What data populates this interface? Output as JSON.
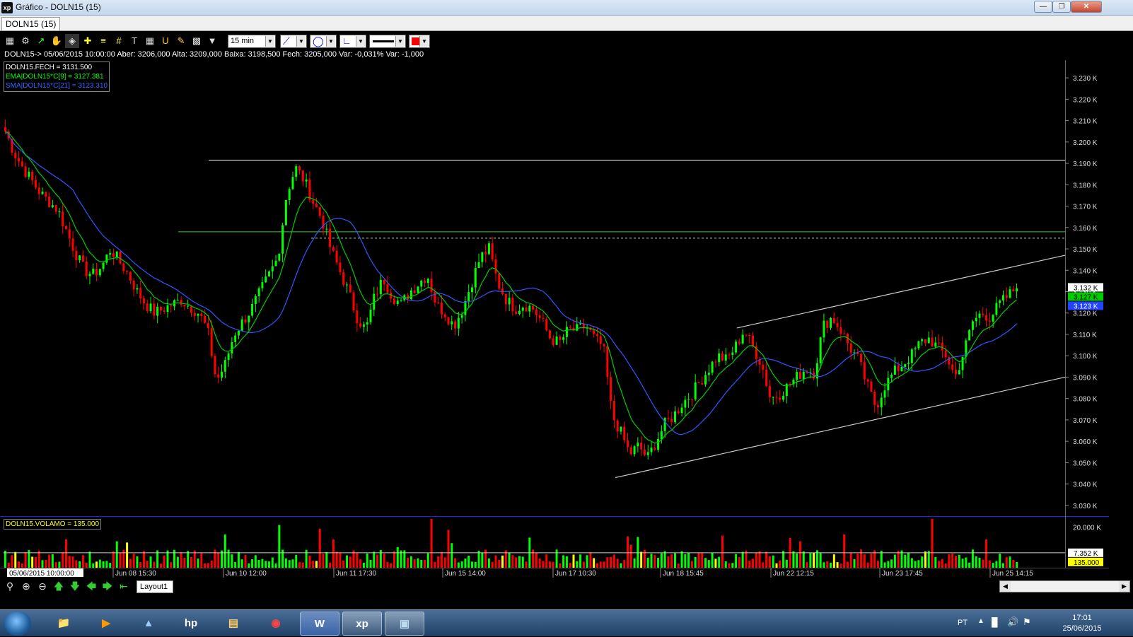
{
  "window": {
    "title": "Gráfico - DOLN15 (15)",
    "app_icon": "xp",
    "minimize_icon": "minimize-icon",
    "maximize_icon": "restore-icon",
    "close_icon": "close-icon"
  },
  "tab": {
    "label": "DOLN15 (15)"
  },
  "toolbar": {
    "interval": "15 min",
    "tools": [
      "chart-settings-icon",
      "gear-icon",
      "line-study-icon",
      "hand-icon",
      "indicator-icon",
      "crosshair-icon",
      "fibonacci-icon",
      "grid-icon",
      "text-icon",
      "calculator-icon",
      "magnet-icon",
      "paint-icon",
      "clipboard-icon",
      "filter-icon"
    ],
    "draw_color": "#ff0000"
  },
  "info_line": "DOLN15-> 05/06/2015 10:00:00 Aber: 3206,000 Alta: 3209,000 Baixa: 3198,500 Fech: 3205,000 Var: -0,031% Var: -1,000",
  "legend": [
    {
      "text": "DOLN15.FECH = 3131.500",
      "color": "#ffffff"
    },
    {
      "text": "EMA|DOLN15*C[9] = 3127.381",
      "color": "#00ff00"
    },
    {
      "text": "SMA|DOLN15*C[21] = 3123.310",
      "color": "#3366ff"
    }
  ],
  "volume_label": "DOLN15.VOLAMO = 135.000",
  "price_axis": {
    "ticks": [
      "3.230 K",
      "3.220 K",
      "3.210 K",
      "3.200 K",
      "3.190 K",
      "3.180 K",
      "3.170 K",
      "3.160 K",
      "3.150 K",
      "3.140 K",
      "3.130 K",
      "3.120 K",
      "3.110 K",
      "3.100 K",
      "3.090 K",
      "3.080 K",
      "3.070 K",
      "3.060 K",
      "3.050 K",
      "3.040 K",
      "3.030 K"
    ],
    "last_price": "3.132 K",
    "ema_value": "3.127 K",
    "sma_value": "3.123 K"
  },
  "volume_axis": {
    "tick": "20.000 K",
    "avg_value": "7.352 K",
    "last_value": "135.000"
  },
  "time_axis": [
    "05/06/2015 10:00:00",
    "Jun 08 15:30",
    "Jun 10 12:00",
    "Jun 11 17:30",
    "Jun 15 14:00",
    "Jun 17 10:30",
    "Jun 18 15:45",
    "Jun 22 12:15",
    "Jun 23 17:45",
    "Jun 25 14:15"
  ],
  "bottom_bar": {
    "layout_tab": "Layout1",
    "nav_icons": [
      "zoom-icon",
      "zoom-in-icon",
      "zoom-out-icon",
      "arrow-up-icon",
      "arrow-down-icon",
      "arrow-left-icon",
      "arrow-right-icon",
      "arrow-first-icon"
    ]
  },
  "taskbar": {
    "apps": [
      "folder-icon",
      "media-player-icon",
      "network-icon",
      "hp-icon",
      "scanner-icon",
      "chrome-icon",
      "word-icon",
      "xp-icon",
      "photo-viewer-icon"
    ],
    "language": "PT",
    "time": "17:01",
    "date": "25/06/2015"
  },
  "colors": {
    "up_candle": "#00ff00",
    "down_candle": "#ff0000",
    "ema": "#00cc00",
    "sma": "#3355ff",
    "resistance_line": "#ffffff",
    "green_hline": "#33cc33",
    "channel_lines": "#cccccc"
  },
  "chart_data": {
    "type": "candlestick",
    "symbol": "DOLN15",
    "interval": "15 min",
    "ylim": [
      3025,
      3235
    ],
    "closes_path": [
      3205,
      3195,
      3188,
      3182,
      3176,
      3172,
      3168,
      3158,
      3148,
      3140,
      3138,
      3142,
      3150,
      3144,
      3138,
      3130,
      3124,
      3120,
      3122,
      3124,
      3126,
      3123,
      3120,
      3112,
      3088,
      3096,
      3110,
      3116,
      3122,
      3130,
      3138,
      3146,
      3176,
      3188,
      3182,
      3172,
      3164,
      3150,
      3140,
      3130,
      3118,
      3112,
      3128,
      3136,
      3128,
      3124,
      3130,
      3134,
      3138,
      3124,
      3120,
      3114,
      3122,
      3134,
      3146,
      3150,
      3134,
      3126,
      3122,
      3124,
      3122,
      3116,
      3108,
      3106,
      3112,
      3112,
      3114,
      3108,
      3104,
      3072,
      3064,
      3054,
      3058,
      3052,
      3060,
      3068,
      3072,
      3078,
      3082,
      3088,
      3094,
      3100,
      3098,
      3104,
      3112,
      3104,
      3096,
      3080,
      3082,
      3086,
      3090,
      3094,
      3092,
      3114,
      3118,
      3112,
      3104,
      3098,
      3086,
      3076,
      3086,
      3092,
      3096,
      3100,
      3106,
      3108,
      3104,
      3100,
      3090,
      3102,
      3116,
      3120,
      3118,
      3124,
      3128,
      3132
    ],
    "ema_last": 3127.381,
    "sma_last": 3123.31,
    "last_close": 3131.5,
    "resistance_level": 3191.5,
    "green_level": 3158,
    "dashed_level": 3155,
    "channel_upper": [
      [
        3113,
        3147
      ]
    ],
    "channel_lower": [
      [
        3043,
        3090
      ]
    ],
    "volume_ylim": [
      0,
      25000
    ],
    "volume_avg": 7352
  }
}
